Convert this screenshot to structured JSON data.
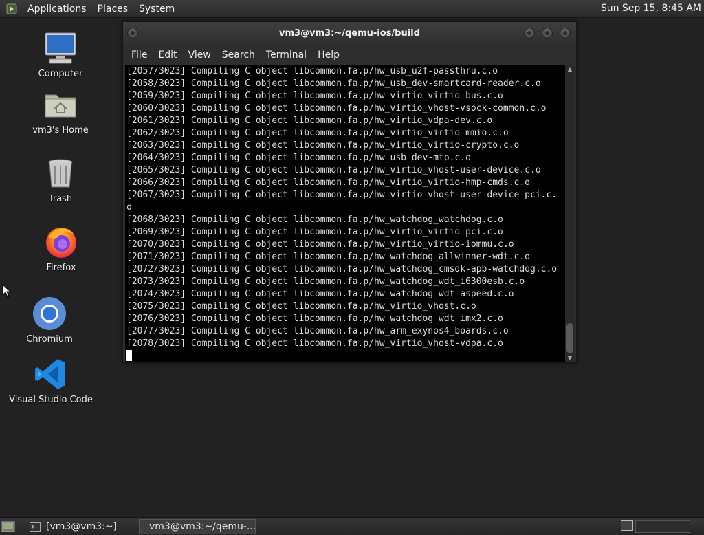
{
  "top_panel": {
    "menus": [
      "Applications",
      "Places",
      "System"
    ],
    "clock": "Sun Sep 15,  8:45 AM"
  },
  "desktop_icons": [
    {
      "label": "Computer",
      "icon": "computer-icon"
    },
    {
      "label": "vm3's Home",
      "icon": "home-folder-icon"
    },
    {
      "label": "Trash",
      "icon": "trash-icon"
    },
    {
      "label": "Firefox",
      "icon": "firefox-icon"
    },
    {
      "label": "Chromium",
      "icon": "chromium-icon"
    },
    {
      "label": "Visual Studio Code",
      "icon": "vscode-icon"
    }
  ],
  "window": {
    "title": "vm3@vm3:~/qemu-ios/build",
    "menus": [
      "File",
      "Edit",
      "View",
      "Search",
      "Terminal",
      "Help"
    ]
  },
  "terminal": {
    "lines": [
      "[2057/3023] Compiling C object libcommon.fa.p/hw_usb_u2f-passthru.c.o",
      "[2058/3023] Compiling C object libcommon.fa.p/hw_usb_dev-smartcard-reader.c.o",
      "[2059/3023] Compiling C object libcommon.fa.p/hw_virtio_virtio-bus.c.o",
      "[2060/3023] Compiling C object libcommon.fa.p/hw_virtio_vhost-vsock-common.c.o",
      "[2061/3023] Compiling C object libcommon.fa.p/hw_virtio_vdpa-dev.c.o",
      "[2062/3023] Compiling C object libcommon.fa.p/hw_virtio_virtio-mmio.c.o",
      "[2063/3023] Compiling C object libcommon.fa.p/hw_virtio_virtio-crypto.c.o",
      "[2064/3023] Compiling C object libcommon.fa.p/hw_usb_dev-mtp.c.o",
      "[2065/3023] Compiling C object libcommon.fa.p/hw_virtio_vhost-user-device.c.o",
      "[2066/3023] Compiling C object libcommon.fa.p/hw_virtio_virtio-hmp-cmds.c.o",
      "[2067/3023] Compiling C object libcommon.fa.p/hw_virtio_vhost-user-device-pci.c.",
      "o",
      "[2068/3023] Compiling C object libcommon.fa.p/hw_watchdog_watchdog.c.o",
      "[2069/3023] Compiling C object libcommon.fa.p/hw_virtio_virtio-pci.c.o",
      "[2070/3023] Compiling C object libcommon.fa.p/hw_virtio_virtio-iommu.c.o",
      "[2071/3023] Compiling C object libcommon.fa.p/hw_watchdog_allwinner-wdt.c.o",
      "[2072/3023] Compiling C object libcommon.fa.p/hw_watchdog_cmsdk-apb-watchdog.c.o",
      "[2073/3023] Compiling C object libcommon.fa.p/hw_watchdog_wdt_i6300esb.c.o",
      "[2074/3023] Compiling C object libcommon.fa.p/hw_watchdog_wdt_aspeed.c.o",
      "[2075/3023] Compiling C object libcommon.fa.p/hw_virtio_vhost.c.o",
      "[2076/3023] Compiling C object libcommon.fa.p/hw_watchdog_wdt_imx2.c.o",
      "[2077/3023] Compiling C object libcommon.fa.p/hw_arm_exynos4_boards.c.o",
      "[2078/3023] Compiling C object libcommon.fa.p/hw_virtio_vhost-vdpa.c.o"
    ]
  },
  "taskbar": {
    "tasks": [
      {
        "label": "[vm3@vm3:~]",
        "active": false
      },
      {
        "label": "vm3@vm3:~/qemu-...",
        "active": true
      }
    ]
  }
}
